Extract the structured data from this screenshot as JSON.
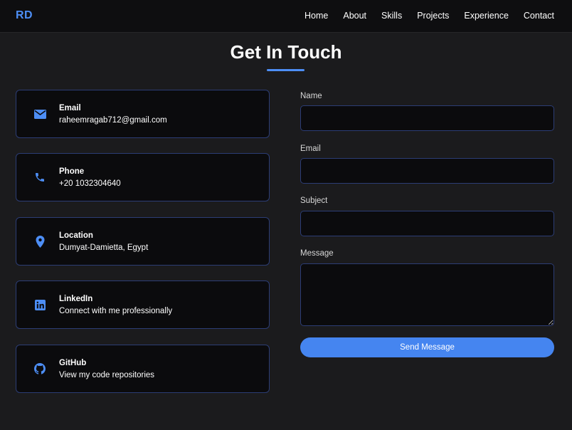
{
  "nav": {
    "brand": "RD",
    "links": [
      "Home",
      "About",
      "Skills",
      "Projects",
      "Experience",
      "Contact"
    ]
  },
  "section": {
    "title": "Get In Touch"
  },
  "contact_cards": [
    {
      "icon": "envelope-icon",
      "title": "Email",
      "value": "raheemragab712@gmail.com"
    },
    {
      "icon": "phone-icon",
      "title": "Phone",
      "value": "+20 1032304640"
    },
    {
      "icon": "location-pin-icon",
      "title": "Location",
      "value": "Dumyat-Damietta, Egypt"
    },
    {
      "icon": "linkedin-icon",
      "title": "LinkedIn",
      "value": "Connect with me professionally"
    },
    {
      "icon": "github-icon",
      "title": "GitHub",
      "value": "View my code repositories"
    }
  ],
  "form": {
    "name_label": "Name",
    "name_value": "",
    "email_label": "Email",
    "email_value": "",
    "subject_label": "Subject",
    "subject_value": "",
    "message_label": "Message",
    "message_value": "",
    "submit_label": "Send Message"
  },
  "colors": {
    "accent": "#4d8ef5",
    "background": "#1b1b1d",
    "navbar": "#0e0e10",
    "card": "#0b0b0d",
    "card_border": "#2c3d75",
    "button": "#4585f0"
  }
}
